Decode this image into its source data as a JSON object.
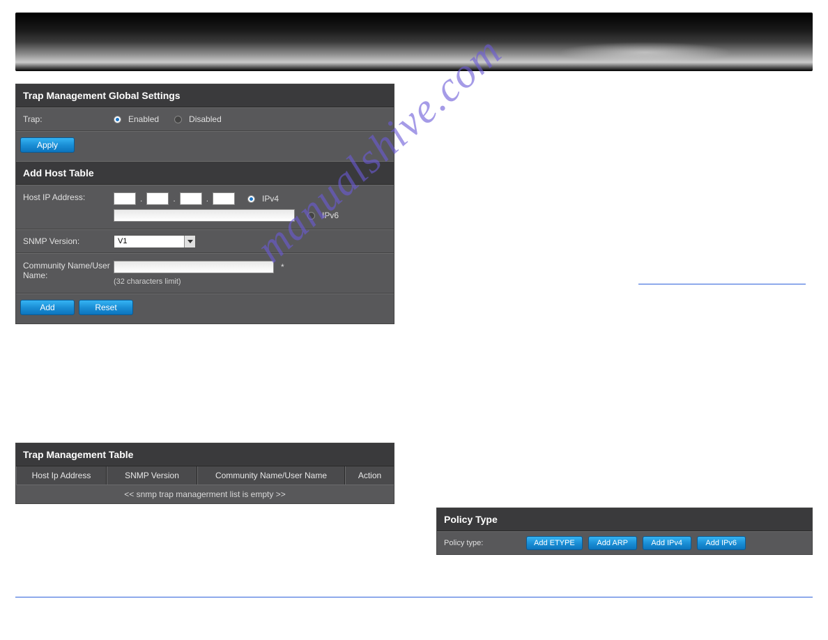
{
  "watermark": "manualshive.com",
  "banner": {},
  "trap_global": {
    "title": "Trap Management Global Settings",
    "trap_label": "Trap:",
    "enabled_label": "Enabled",
    "disabled_label": "Disabled",
    "selected": "Enabled",
    "apply_label": "Apply"
  },
  "add_host": {
    "title": "Add Host Table",
    "host_ip_label": "Host IP Address:",
    "ipv4_label": "IPv4",
    "ipv6_label": "IPv6",
    "ip_selected": "IPv4",
    "snmp_label": "SNMP Version:",
    "snmp_value": "V1",
    "community_label": "Community Name/User Name:",
    "community_hint": "(32 characters limit)",
    "add_label": "Add",
    "reset_label": "Reset"
  },
  "trap_table": {
    "title": "Trap Management Table",
    "col1": "Host Ip Address",
    "col2": "SNMP Version",
    "col3": "Community Name/User Name",
    "col4": "Action",
    "empty": "<< snmp trap managerment list is empty >>"
  },
  "right": {
    "title_text": " ",
    "link_text": " "
  },
  "policy": {
    "title": "Policy Type",
    "label": "Policy type:",
    "buttons": [
      "Add ETYPE",
      "Add ARP",
      "Add IPv4",
      "Add IPv6"
    ]
  }
}
